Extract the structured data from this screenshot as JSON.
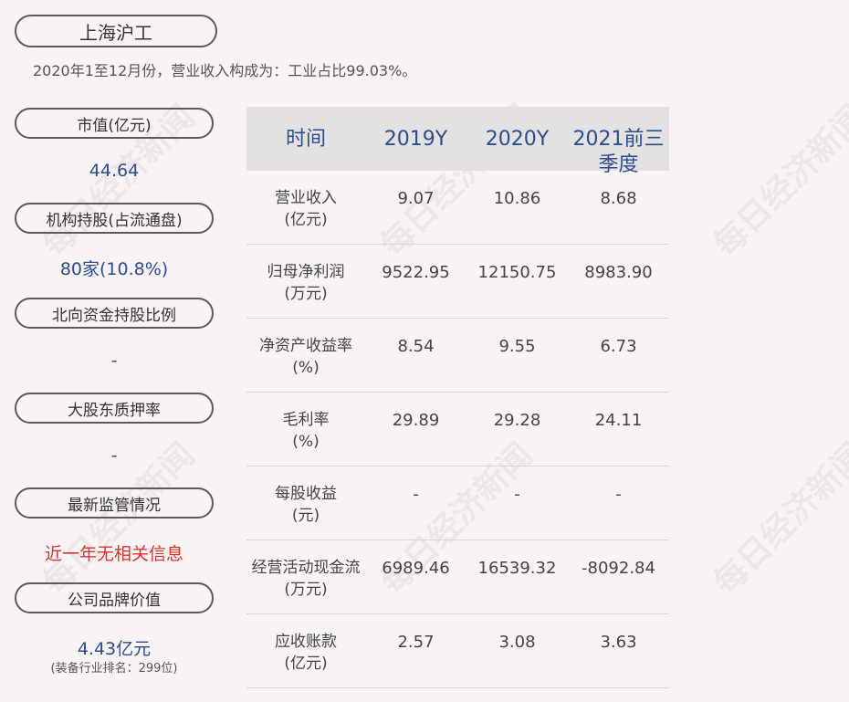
{
  "company": "上海沪工",
  "subtitle": "2020年1至12月份，营业收入构成为：工业占比99.03%。",
  "left_panel": [
    {
      "label": "市值(亿元)",
      "value": "44.64"
    },
    {
      "label": "机构持股(占流通盘)",
      "value": "80家(10.8%)"
    },
    {
      "label": "北向资金持股比例",
      "value": "-"
    },
    {
      "label": "大股东质押率",
      "value": "-"
    },
    {
      "label": "最新监管情况",
      "value": "近一年无相关信息"
    },
    {
      "label": "公司品牌价值",
      "value": "4.43亿元",
      "note": "(装备行业排名：299位)"
    }
  ],
  "table": {
    "headers": [
      "时间",
      "2019Y",
      "2020Y",
      "2021前三季度"
    ],
    "rows": [
      {
        "label": [
          "营业收入",
          "(亿元)"
        ],
        "values": [
          "9.07",
          "10.86",
          "8.68"
        ]
      },
      {
        "label": [
          "归母净利润",
          "(万元)"
        ],
        "values": [
          "9522.95",
          "12150.75",
          "8983.90"
        ]
      },
      {
        "label": [
          "净资产收益率",
          "(%)"
        ],
        "values": [
          "8.54",
          "9.55",
          "6.73"
        ]
      },
      {
        "label": [
          "毛利率",
          "(%)"
        ],
        "values": [
          "29.89",
          "29.28",
          "24.11"
        ]
      },
      {
        "label": [
          "每股收益",
          "(元)"
        ],
        "values": [
          "-",
          "-",
          "-"
        ]
      },
      {
        "label": [
          "经营活动现金流",
          "(万元)"
        ],
        "values": [
          "6989.46",
          "16539.32",
          "-8092.84"
        ]
      },
      {
        "label": [
          "应收账款",
          "(亿元)"
        ],
        "values": [
          "2.57",
          "3.08",
          "3.63"
        ]
      }
    ]
  },
  "watermark": "每日经济新闻"
}
